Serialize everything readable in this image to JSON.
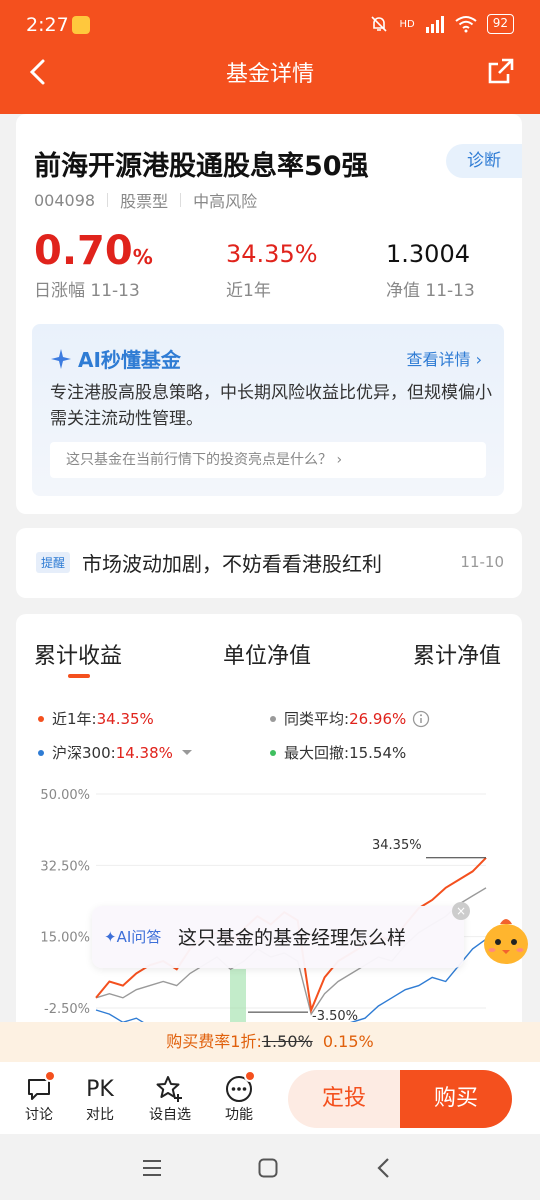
{
  "status": {
    "time": "2:27",
    "network": "HD",
    "battery": "92"
  },
  "nav": {
    "title": "基金详情"
  },
  "fund": {
    "name": "前海开源港股通股息率50强",
    "diagnose_label": "诊断",
    "code": "004098",
    "type": "股票型",
    "risk": "中高风险",
    "day_change_value": "0.70",
    "day_change_unit": "%",
    "day_change_label": "日涨幅 11-13",
    "year_return": "34.35%",
    "year_return_label": "近1年",
    "nav_value": "1.3004",
    "nav_label": "净值 11-13"
  },
  "ai_summary": {
    "title": "AI秒懂基金",
    "link_label": "查看详情",
    "description": "专注港股高股息策略，中长期风险收益比优异，但规模偏小需关注流动性管理。",
    "question": "这只基金在当前行情下的投资亮点是什么？"
  },
  "notice": {
    "badge": "提醒",
    "text": "市场波动加剧，不妨看看港股红利",
    "date": "11-10"
  },
  "chart_tabs": [
    "累计收益",
    "单位净值",
    "累计净值"
  ],
  "legend": {
    "fund": {
      "label": "近1年:",
      "value": "34.35%",
      "color": "#f4501e"
    },
    "peer": {
      "label": "同类平均:",
      "value": "26.96%",
      "color": "#9a9a9a"
    },
    "index": {
      "label": "沪深300:",
      "value": "14.38%",
      "color": "#2f7cd4"
    },
    "drawdown": {
      "label": "最大回撤:",
      "value": "15.54%",
      "color": "#3fbf5f"
    }
  },
  "chart_data": {
    "type": "line",
    "y_ticks": [
      "50.00%",
      "32.50%",
      "15.00%",
      "-2.50%"
    ],
    "ylim": [
      -10,
      50
    ],
    "annotations": [
      "34.35%",
      "-3.50%"
    ],
    "series": [
      {
        "name": "近1年",
        "values": [
          0,
          4,
          3,
          6,
          8,
          9,
          7,
          12,
          15,
          16,
          13,
          17,
          20,
          18,
          21,
          19,
          -3,
          5,
          9,
          11,
          13,
          15,
          14,
          18,
          22,
          24,
          27,
          29,
          31,
          34.35
        ]
      },
      {
        "name": "同类平均",
        "values": [
          0,
          1,
          0,
          2,
          3,
          4,
          3,
          6,
          8,
          10,
          7,
          9,
          12,
          10,
          11,
          9,
          -4,
          1,
          4,
          6,
          8,
          10,
          9,
          13,
          16,
          18,
          20,
          23,
          25,
          26.96
        ]
      },
      {
        "name": "沪深300",
        "values": [
          -3,
          -4,
          -6,
          -5,
          -7,
          -8,
          -9,
          -7,
          -9,
          -10,
          -8,
          -9,
          -10,
          -9,
          -11,
          -10,
          -9,
          -8,
          -7,
          -6,
          -5,
          -2,
          0,
          2,
          3,
          5,
          4,
          8,
          12,
          14.38
        ]
      }
    ]
  },
  "ai_float": {
    "label": "AI问答",
    "text": "这只基金的基金经理怎么样"
  },
  "fee": {
    "prefix": "购买费率1折:",
    "original": "1.50%",
    "discounted": "0.15%"
  },
  "bottom_bar": {
    "discuss": "讨论",
    "pk_icon": "PK",
    "pk": "对比",
    "watch": "设自选",
    "more": "功能",
    "sip": "定投",
    "buy": "购买"
  }
}
